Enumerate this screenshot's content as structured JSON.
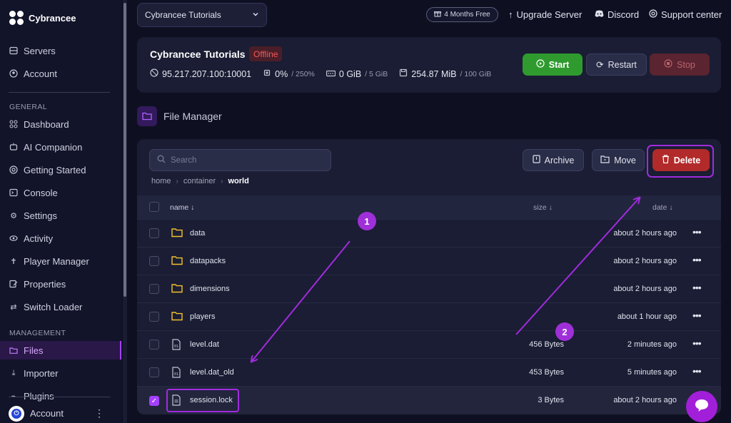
{
  "brand": {
    "name": "Cybrancee"
  },
  "sidebar": {
    "top_items": [
      {
        "label": "Servers",
        "icon": "servers-icon"
      },
      {
        "label": "Account",
        "icon": "account-icon"
      }
    ],
    "general_heading": "GENERAL",
    "general_items": [
      {
        "label": "Dashboard",
        "icon": "dashboard-icon"
      },
      {
        "label": "AI Companion",
        "icon": "ai-icon"
      },
      {
        "label": "Getting Started",
        "icon": "lifebuoy-icon"
      },
      {
        "label": "Console",
        "icon": "terminal-icon"
      },
      {
        "label": "Settings",
        "icon": "gear-icon"
      },
      {
        "label": "Activity",
        "icon": "eye-icon"
      },
      {
        "label": "Player Manager",
        "icon": "person-icon"
      },
      {
        "label": "Properties",
        "icon": "edit-icon"
      },
      {
        "label": "Switch Loader",
        "icon": "switch-icon"
      }
    ],
    "management_heading": "MANAGEMENT",
    "management_items": [
      {
        "label": "Files",
        "icon": "folder-icon",
        "active": true
      },
      {
        "label": "Importer",
        "icon": "download-icon"
      },
      {
        "label": "Plugins",
        "icon": "plug-icon"
      }
    ],
    "footer": {
      "label": "Account"
    }
  },
  "topbar": {
    "server_select": "Cybrancee Tutorials",
    "promo": "4 Months Free",
    "upgrade": "Upgrade Server",
    "discord": "Discord",
    "support": "Support center"
  },
  "server": {
    "name": "Cybrancee Tutorials",
    "status": "Offline",
    "address": "95.217.207.100:10001",
    "cpu": "0%",
    "cpu_limit": "/ 250%",
    "memory": "0 GiB",
    "memory_limit": "/ 5 GiB",
    "disk": "254.87 MiB",
    "disk_limit": "/ 100 GiB",
    "start_label": "Start",
    "restart_label": "Restart",
    "stop_label": "Stop",
    "colors": {
      "start": "#2f9a2e",
      "stop": "#5a2430",
      "offline": "#f05a5a"
    }
  },
  "file_manager": {
    "title": "File Manager",
    "search_placeholder": "Search",
    "archive_label": "Archive",
    "move_label": "Move",
    "delete_label": "Delete",
    "breadcrumb": [
      "home",
      "container",
      "world"
    ],
    "columns": {
      "name": "name ↓",
      "size": "size ↓",
      "date": "date ↓"
    },
    "files": [
      {
        "name": "data",
        "type": "folder",
        "size": "",
        "date": "about 2 hours ago",
        "checked": false
      },
      {
        "name": "datapacks",
        "type": "folder",
        "size": "",
        "date": "about 2 hours ago",
        "checked": false
      },
      {
        "name": "dimensions",
        "type": "folder",
        "size": "",
        "date": "about 2 hours ago",
        "checked": false
      },
      {
        "name": "players",
        "type": "folder",
        "size": "",
        "date": "about 1 hour ago",
        "checked": false
      },
      {
        "name": "level.dat",
        "type": "file",
        "size": "456 Bytes",
        "date": "2 minutes ago",
        "checked": false
      },
      {
        "name": "level.dat_old",
        "type": "file",
        "size": "453 Bytes",
        "date": "5 minutes ago",
        "checked": false
      },
      {
        "name": "session.lock",
        "type": "file",
        "size": "3 Bytes",
        "date": "about 2 hours ago",
        "checked": true
      }
    ]
  },
  "annotations": {
    "step1": "1",
    "step2": "2",
    "accent": "#a12bde"
  }
}
